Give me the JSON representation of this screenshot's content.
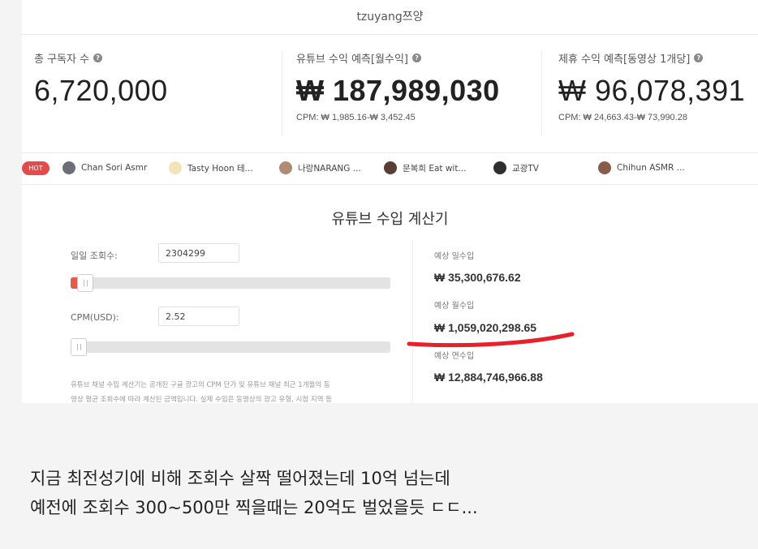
{
  "header": {
    "channel_name": "tzuyang쯔양"
  },
  "stats": [
    {
      "label": "총 구독자 수",
      "value": "6,720,000",
      "note": ""
    },
    {
      "label": "유튜브 수익 예측[월수익]",
      "value": "₩ 187,989,030",
      "note": "CPM: ₩ 1,985.16-₩ 3,452.45"
    },
    {
      "label": "제휴 수익 예측[동영상 1개당]",
      "value": "₩ 96,078,391",
      "note": "CPM: ₩ 24,663.43-₩ 73,990.28"
    }
  ],
  "hot": {
    "badge": "HOT",
    "items": [
      {
        "name": "Chan Sori Asmr",
        "avatar_color": "#6b6f78"
      },
      {
        "name": "Tasty Hoon 테...",
        "avatar_color": "#f3e3b8"
      },
      {
        "name": "나랑NARANG ...",
        "avatar_color": "#b08a72"
      },
      {
        "name": "문복희 Eat wit...",
        "avatar_color": "#5a3e33"
      },
      {
        "name": "교광TV",
        "avatar_color": "#2f2f2f"
      },
      {
        "name": "Chihun ASMR ...",
        "avatar_color": "#8a5a4a"
      }
    ]
  },
  "calculator": {
    "title": "유튜브 수입 계산기",
    "views_label": "일일 조회수:",
    "views_value": "2304299",
    "cpm_label": "CPM(USD):",
    "cpm_value": "2.52",
    "note_line1": "유튜브 채널 수입 계산기는 공개된 구글 광고의 CPM 단가 및 유튜브 채널 최근 1개월의 동",
    "note_line2": "영상 평균 조회수에 따라 계산된 금액입니다. 실제 수입은 동영상의 광고 유형, 시청 지역 등",
    "daily_label": "예상 일수입",
    "daily_value": "₩ 35,300,676.62",
    "monthly_label": "예상 월수입",
    "monthly_value": "₩ 1,059,020,298.65",
    "yearly_label": "예상 연수입",
    "yearly_value": "₩ 12,884,746,966.88"
  },
  "caption": {
    "line1": "지금 최전성기에 비해 조회수 살짝 떨어졌는데 10억 넘는데",
    "line2": "예전에 조회수 300~500만 찍을때는 20억도 벌었을듯 ㄷㄷ..."
  },
  "colors": {
    "hot_badge": "#e44b4b",
    "slider_fill": "#e05c4b",
    "highlight_mark": "#e8202a"
  }
}
